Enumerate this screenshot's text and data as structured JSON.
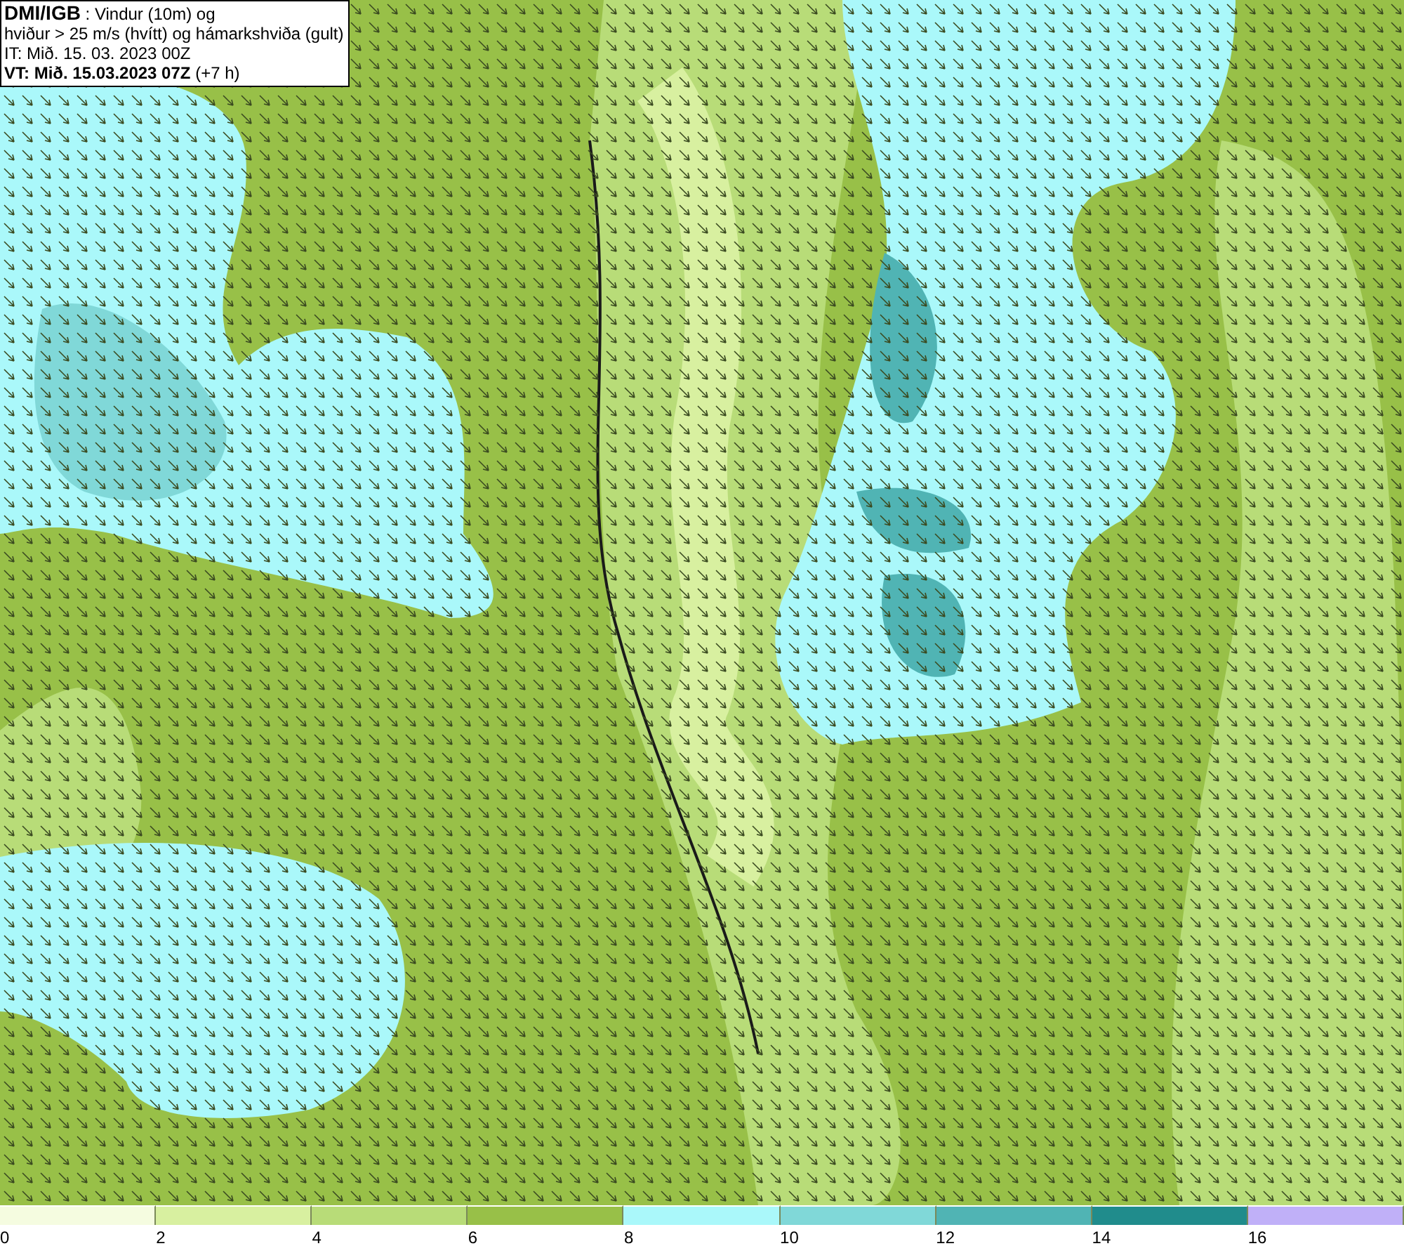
{
  "title_box": {
    "lines": [
      "**DMI/IGB** : Vindur (10m) og",
      "hviður > 25 m/s (hvítt) og hámarkshviða (gult)",
      "IT: Mið. 15. 03. 2023 00Z",
      "**VT: Mið. 15.03.2023 07Z** (+7 h)"
    ]
  },
  "legend": {
    "bins": [
      {
        "color": "#f5fce0",
        "label": "0"
      },
      {
        "color": "#d8f0a0",
        "label": "2"
      },
      {
        "color": "#b8dc78",
        "label": "4"
      },
      {
        "color": "#98c048",
        "label": "6"
      },
      {
        "color": "#aaf8fa",
        "label": "8"
      },
      {
        "color": "#80d8d8",
        "label": "10"
      },
      {
        "color": "#50b4b4",
        "label": "12"
      },
      {
        "color": "#208c8c",
        "label": "14"
      },
      {
        "color": "#c0b0f8",
        "label": "16"
      }
    ]
  }
}
